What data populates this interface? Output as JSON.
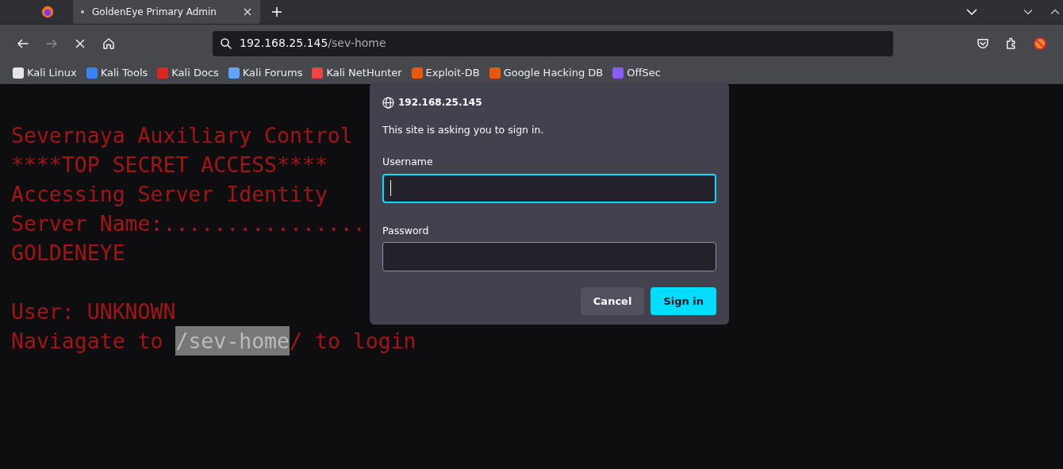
{
  "tabs": [
    {
      "title": "GoldenEye Primary Admin",
      "selected": true,
      "loading": true
    }
  ],
  "address_bar": {
    "host": "192.168.25.145",
    "path": "/sev-home"
  },
  "bookmarks": [
    {
      "label": "Kali Linux",
      "color": "#e5e5e5"
    },
    {
      "label": "Kali Tools",
      "color": "#3b82f6"
    },
    {
      "label": "Kali Docs",
      "color": "#dc2626"
    },
    {
      "label": "Kali Forums",
      "color": "#60a5fa"
    },
    {
      "label": "Kali NetHunter",
      "color": "#ef4444"
    },
    {
      "label": "Exploit-DB",
      "color": "#ea580c"
    },
    {
      "label": "Google Hacking DB",
      "color": "#ea580c"
    },
    {
      "label": "OffSec",
      "color": "#8b5cf6"
    }
  ],
  "page_lines": [
    [
      {
        "text": "Severnaya Auxiliary Control",
        "highlighted": false
      }
    ],
    [
      {
        "text": "****TOP SECRET ACCESS****",
        "highlighted": false
      }
    ],
    [
      {
        "text": "Accessing Server Identity",
        "highlighted": false
      }
    ],
    [
      {
        "text": "Server Name:................",
        "highlighted": false
      }
    ],
    [
      {
        "text": "GOLDENEYE",
        "highlighted": false
      }
    ],
    {
      "kind": "blank"
    },
    [
      {
        "text": "User: UNKNOWN",
        "highlighted": false
      }
    ],
    [
      {
        "text": "Naviagate to ",
        "highlighted": false
      },
      {
        "text": "/sev-home",
        "highlighted": true
      },
      {
        "text": "/ to login",
        "highlighted": false
      }
    ]
  ],
  "auth_dialog": {
    "host": "192.168.25.145",
    "message": "This site is asking you to sign in.",
    "fields": [
      {
        "label": "Username",
        "focused": true
      },
      {
        "label": "Password",
        "focused": false
      }
    ],
    "buttons": [
      {
        "label": "Cancel",
        "kind": "secondary"
      },
      {
        "label": "Sign in",
        "kind": "primary"
      }
    ]
  }
}
